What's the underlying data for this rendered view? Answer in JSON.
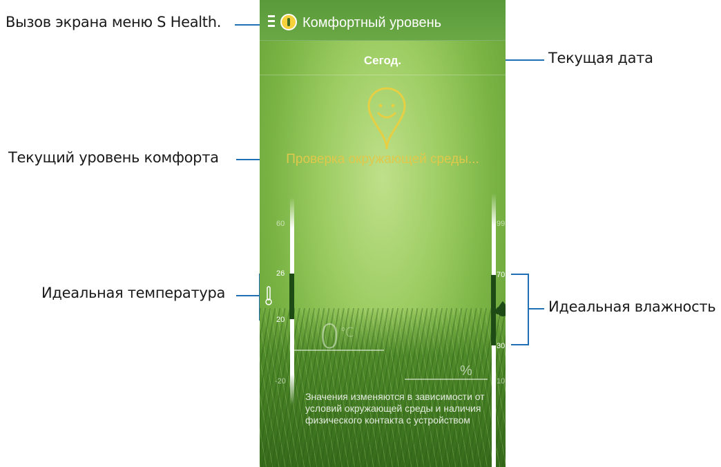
{
  "callouts": {
    "menu": "Вызов экрана меню S Health.",
    "date": "Текущая дата",
    "comfort": "Текущий уровень комфорта",
    "temperature": "Идеальная температура",
    "humidity": "Идеальная влажность"
  },
  "app": {
    "title": "Комфортный уровень",
    "date": "Сегод.",
    "status": "Проверка окружающей среды...",
    "note": "Значения изменяются в зависимости от условий окружающей среды и наличия физического контакта с устройством"
  },
  "temperature": {
    "ticks": [
      "60",
      "26",
      "20",
      "-20"
    ],
    "value": "0",
    "unit": "℃"
  },
  "humidity": {
    "ticks": [
      "99",
      "70",
      "30",
      "10"
    ],
    "unit": "%"
  },
  "colors": {
    "accent": "#1f6fb5",
    "status_text": "#e0c84a",
    "range_bar": "#1e4a16"
  }
}
